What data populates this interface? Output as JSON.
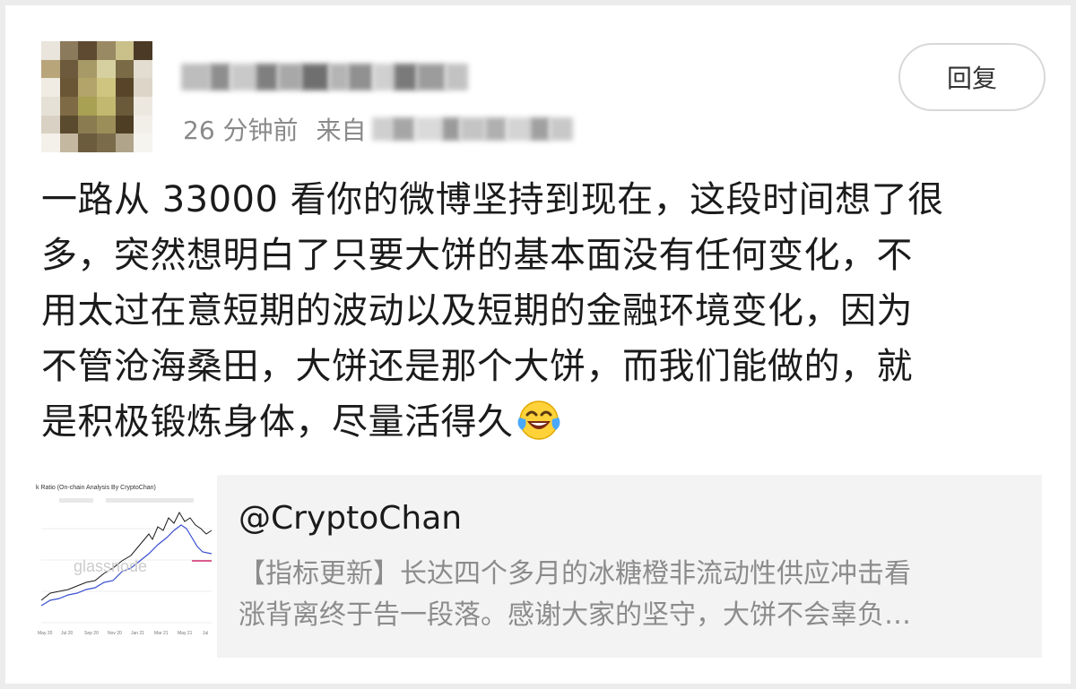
{
  "post": {
    "meta": {
      "time": "26 分钟前",
      "source_prefix": "来自"
    },
    "reply_label": "回复",
    "text_lines": [
      "一路从 33000 看你的微博坚持到现在，这段时间想了很",
      "多，突然想明白了只要大饼的基本面没有任何变化，不",
      "用太过在意短期的波动以及短期的金融环境变化，因为",
      "不管沧海桑田，大饼还是那个大饼，而我们能做的，就",
      "是积极锻炼身体，尽量活得久"
    ],
    "emoji": "laughing-with-tears-emoji"
  },
  "repost": {
    "author": "@CryptoChan",
    "text_lines": [
      "【指标更新】长达四个多月的冰糖橙非流动性供应冲击看",
      "涨背离终于告一段落。感谢大家的坚守，大饼不会辜负…"
    ],
    "thumbnail": {
      "title": "k Ratio (On-chain Analysis By CryptoChan)",
      "watermark": "glassnode",
      "x_ticks": [
        "May 20",
        "Jul 20",
        "Sep 20",
        "Nov 20",
        "Jan 21",
        "Mar 21",
        "May 21",
        "Jul"
      ],
      "series_colors": [
        "#1a1a1a",
        "#3a4fd0",
        "#d02a6a"
      ]
    }
  },
  "colors": {
    "background": "#ececec",
    "card": "#ffffff",
    "text_primary": "#1b1b1b",
    "text_secondary": "#8a8a8a",
    "repost_background": "#f3f3f3",
    "button_border": "#d8d8d8"
  }
}
